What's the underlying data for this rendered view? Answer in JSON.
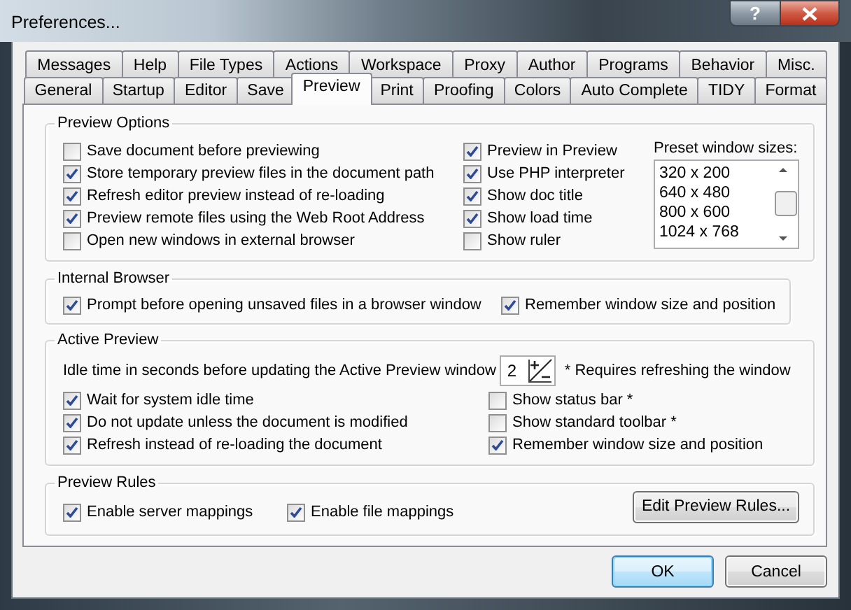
{
  "window": {
    "title": "Preferences...",
    "help_button": "?"
  },
  "tabs": [
    [
      {
        "label": "Messages",
        "selected": false
      },
      {
        "label": "Help",
        "selected": false
      },
      {
        "label": "File Types",
        "selected": false
      },
      {
        "label": "Actions",
        "selected": false
      },
      {
        "label": "Workspace",
        "selected": false
      },
      {
        "label": "Proxy",
        "selected": false
      },
      {
        "label": "Author",
        "selected": false
      },
      {
        "label": "Programs",
        "selected": false
      },
      {
        "label": "Behavior",
        "selected": false
      },
      {
        "label": "Misc.",
        "selected": false
      }
    ],
    [
      {
        "label": "General",
        "selected": false
      },
      {
        "label": "Startup",
        "selected": false
      },
      {
        "label": "Editor",
        "selected": false
      },
      {
        "label": "Save",
        "selected": false
      },
      {
        "label": "Preview",
        "selected": true
      },
      {
        "label": "Print",
        "selected": false
      },
      {
        "label": "Proofing",
        "selected": false
      },
      {
        "label": "Colors",
        "selected": false
      },
      {
        "label": "Auto Complete",
        "selected": false
      },
      {
        "label": "TIDY",
        "selected": false
      },
      {
        "label": "Format",
        "selected": false
      }
    ]
  ],
  "preview_options": {
    "title": "Preview Options",
    "left": [
      {
        "label": "Save document before previewing",
        "checked": false
      },
      {
        "label": "Store temporary preview files in the document path",
        "checked": true
      },
      {
        "label": "Refresh editor preview instead of re-loading",
        "checked": true
      },
      {
        "label": "Preview remote files using the Web Root Address",
        "checked": true
      },
      {
        "label": "Open new windows in external browser",
        "checked": false
      }
    ],
    "right": [
      {
        "label": "Preview in Preview",
        "checked": true
      },
      {
        "label": "Use PHP interpreter",
        "checked": true
      },
      {
        "label": "Show doc title",
        "checked": true
      },
      {
        "label": "Show load time",
        "checked": true
      },
      {
        "label": "Show ruler",
        "checked": false
      }
    ],
    "preset_sizes": {
      "label": "Preset window sizes:",
      "items": [
        "320 x 200",
        "640 x 480",
        "800 x 600",
        "1024 x 768"
      ]
    }
  },
  "internal_browser": {
    "title": "Internal Browser",
    "options": [
      {
        "label": "Prompt before opening unsaved files in a browser window",
        "checked": true
      },
      {
        "label": "Remember window size and position",
        "checked": true
      }
    ]
  },
  "active_preview": {
    "title": "Active Preview",
    "idle_label": "Idle time in seconds before updating the Active Preview window",
    "idle_value": "2",
    "note": "* Requires refreshing the window",
    "left": [
      {
        "label": "Wait for system idle time",
        "checked": true
      },
      {
        "label": "Do not update unless the document is modified",
        "checked": true
      },
      {
        "label": "Refresh instead of re-loading the document",
        "checked": true
      }
    ],
    "right": [
      {
        "label": "Show status bar *",
        "checked": false
      },
      {
        "label": "Show standard toolbar *",
        "checked": false
      },
      {
        "label": "Remember window size and position",
        "checked": true
      }
    ]
  },
  "preview_rules": {
    "title": "Preview Rules",
    "options": [
      {
        "label": "Enable server mappings",
        "checked": true
      },
      {
        "label": "Enable file mappings",
        "checked": true
      }
    ],
    "button": "Edit Preview Rules..."
  },
  "buttons": [
    {
      "label": "OK",
      "default": true
    },
    {
      "label": "Cancel",
      "default": false
    }
  ]
}
